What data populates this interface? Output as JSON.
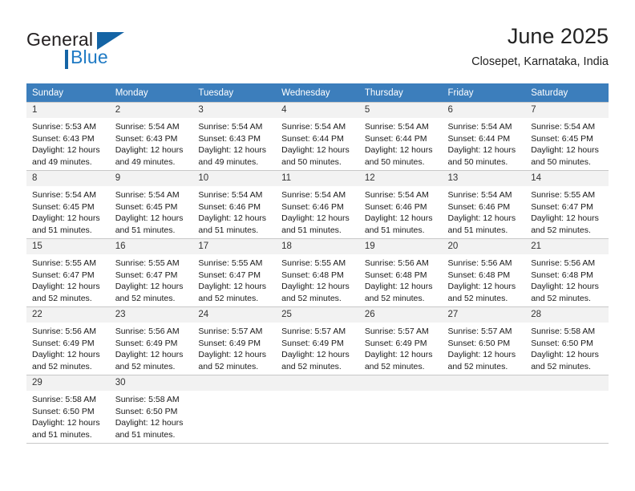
{
  "brand": {
    "word1": "General",
    "word2": "Blue",
    "triangle_color": "#1464a5",
    "blue_color": "#1f7ac4"
  },
  "header": {
    "title": "June 2025",
    "subtitle": "Closepet, Karnataka, India"
  },
  "theme": {
    "header_row_bg": "#3c7ebc",
    "daynum_bg": "#f2f2f2",
    "grid_line": "#c8c8c8"
  },
  "weekday_headers": [
    "Sunday",
    "Monday",
    "Tuesday",
    "Wednesday",
    "Thursday",
    "Friday",
    "Saturday"
  ],
  "weeks": [
    [
      {
        "day": "1",
        "sunrise": "Sunrise: 5:53 AM",
        "sunset": "Sunset: 6:43 PM",
        "daylight1": "Daylight: 12 hours",
        "daylight2": "and 49 minutes."
      },
      {
        "day": "2",
        "sunrise": "Sunrise: 5:54 AM",
        "sunset": "Sunset: 6:43 PM",
        "daylight1": "Daylight: 12 hours",
        "daylight2": "and 49 minutes."
      },
      {
        "day": "3",
        "sunrise": "Sunrise: 5:54 AM",
        "sunset": "Sunset: 6:43 PM",
        "daylight1": "Daylight: 12 hours",
        "daylight2": "and 49 minutes."
      },
      {
        "day": "4",
        "sunrise": "Sunrise: 5:54 AM",
        "sunset": "Sunset: 6:44 PM",
        "daylight1": "Daylight: 12 hours",
        "daylight2": "and 50 minutes."
      },
      {
        "day": "5",
        "sunrise": "Sunrise: 5:54 AM",
        "sunset": "Sunset: 6:44 PM",
        "daylight1": "Daylight: 12 hours",
        "daylight2": "and 50 minutes."
      },
      {
        "day": "6",
        "sunrise": "Sunrise: 5:54 AM",
        "sunset": "Sunset: 6:44 PM",
        "daylight1": "Daylight: 12 hours",
        "daylight2": "and 50 minutes."
      },
      {
        "day": "7",
        "sunrise": "Sunrise: 5:54 AM",
        "sunset": "Sunset: 6:45 PM",
        "daylight1": "Daylight: 12 hours",
        "daylight2": "and 50 minutes."
      }
    ],
    [
      {
        "day": "8",
        "sunrise": "Sunrise: 5:54 AM",
        "sunset": "Sunset: 6:45 PM",
        "daylight1": "Daylight: 12 hours",
        "daylight2": "and 51 minutes."
      },
      {
        "day": "9",
        "sunrise": "Sunrise: 5:54 AM",
        "sunset": "Sunset: 6:45 PM",
        "daylight1": "Daylight: 12 hours",
        "daylight2": "and 51 minutes."
      },
      {
        "day": "10",
        "sunrise": "Sunrise: 5:54 AM",
        "sunset": "Sunset: 6:46 PM",
        "daylight1": "Daylight: 12 hours",
        "daylight2": "and 51 minutes."
      },
      {
        "day": "11",
        "sunrise": "Sunrise: 5:54 AM",
        "sunset": "Sunset: 6:46 PM",
        "daylight1": "Daylight: 12 hours",
        "daylight2": "and 51 minutes."
      },
      {
        "day": "12",
        "sunrise": "Sunrise: 5:54 AM",
        "sunset": "Sunset: 6:46 PM",
        "daylight1": "Daylight: 12 hours",
        "daylight2": "and 51 minutes."
      },
      {
        "day": "13",
        "sunrise": "Sunrise: 5:54 AM",
        "sunset": "Sunset: 6:46 PM",
        "daylight1": "Daylight: 12 hours",
        "daylight2": "and 51 minutes."
      },
      {
        "day": "14",
        "sunrise": "Sunrise: 5:55 AM",
        "sunset": "Sunset: 6:47 PM",
        "daylight1": "Daylight: 12 hours",
        "daylight2": "and 52 minutes."
      }
    ],
    [
      {
        "day": "15",
        "sunrise": "Sunrise: 5:55 AM",
        "sunset": "Sunset: 6:47 PM",
        "daylight1": "Daylight: 12 hours",
        "daylight2": "and 52 minutes."
      },
      {
        "day": "16",
        "sunrise": "Sunrise: 5:55 AM",
        "sunset": "Sunset: 6:47 PM",
        "daylight1": "Daylight: 12 hours",
        "daylight2": "and 52 minutes."
      },
      {
        "day": "17",
        "sunrise": "Sunrise: 5:55 AM",
        "sunset": "Sunset: 6:47 PM",
        "daylight1": "Daylight: 12 hours",
        "daylight2": "and 52 minutes."
      },
      {
        "day": "18",
        "sunrise": "Sunrise: 5:55 AM",
        "sunset": "Sunset: 6:48 PM",
        "daylight1": "Daylight: 12 hours",
        "daylight2": "and 52 minutes."
      },
      {
        "day": "19",
        "sunrise": "Sunrise: 5:56 AM",
        "sunset": "Sunset: 6:48 PM",
        "daylight1": "Daylight: 12 hours",
        "daylight2": "and 52 minutes."
      },
      {
        "day": "20",
        "sunrise": "Sunrise: 5:56 AM",
        "sunset": "Sunset: 6:48 PM",
        "daylight1": "Daylight: 12 hours",
        "daylight2": "and 52 minutes."
      },
      {
        "day": "21",
        "sunrise": "Sunrise: 5:56 AM",
        "sunset": "Sunset: 6:48 PM",
        "daylight1": "Daylight: 12 hours",
        "daylight2": "and 52 minutes."
      }
    ],
    [
      {
        "day": "22",
        "sunrise": "Sunrise: 5:56 AM",
        "sunset": "Sunset: 6:49 PM",
        "daylight1": "Daylight: 12 hours",
        "daylight2": "and 52 minutes."
      },
      {
        "day": "23",
        "sunrise": "Sunrise: 5:56 AM",
        "sunset": "Sunset: 6:49 PM",
        "daylight1": "Daylight: 12 hours",
        "daylight2": "and 52 minutes."
      },
      {
        "day": "24",
        "sunrise": "Sunrise: 5:57 AM",
        "sunset": "Sunset: 6:49 PM",
        "daylight1": "Daylight: 12 hours",
        "daylight2": "and 52 minutes."
      },
      {
        "day": "25",
        "sunrise": "Sunrise: 5:57 AM",
        "sunset": "Sunset: 6:49 PM",
        "daylight1": "Daylight: 12 hours",
        "daylight2": "and 52 minutes."
      },
      {
        "day": "26",
        "sunrise": "Sunrise: 5:57 AM",
        "sunset": "Sunset: 6:49 PM",
        "daylight1": "Daylight: 12 hours",
        "daylight2": "and 52 minutes."
      },
      {
        "day": "27",
        "sunrise": "Sunrise: 5:57 AM",
        "sunset": "Sunset: 6:50 PM",
        "daylight1": "Daylight: 12 hours",
        "daylight2": "and 52 minutes."
      },
      {
        "day": "28",
        "sunrise": "Sunrise: 5:58 AM",
        "sunset": "Sunset: 6:50 PM",
        "daylight1": "Daylight: 12 hours",
        "daylight2": "and 52 minutes."
      }
    ],
    [
      {
        "day": "29",
        "sunrise": "Sunrise: 5:58 AM",
        "sunset": "Sunset: 6:50 PM",
        "daylight1": "Daylight: 12 hours",
        "daylight2": "and 51 minutes."
      },
      {
        "day": "30",
        "sunrise": "Sunrise: 5:58 AM",
        "sunset": "Sunset: 6:50 PM",
        "daylight1": "Daylight: 12 hours",
        "daylight2": "and 51 minutes."
      },
      {
        "day": "",
        "sunrise": "",
        "sunset": "",
        "daylight1": "",
        "daylight2": ""
      },
      {
        "day": "",
        "sunrise": "",
        "sunset": "",
        "daylight1": "",
        "daylight2": ""
      },
      {
        "day": "",
        "sunrise": "",
        "sunset": "",
        "daylight1": "",
        "daylight2": ""
      },
      {
        "day": "",
        "sunrise": "",
        "sunset": "",
        "daylight1": "",
        "daylight2": ""
      },
      {
        "day": "",
        "sunrise": "",
        "sunset": "",
        "daylight1": "",
        "daylight2": ""
      }
    ]
  ]
}
